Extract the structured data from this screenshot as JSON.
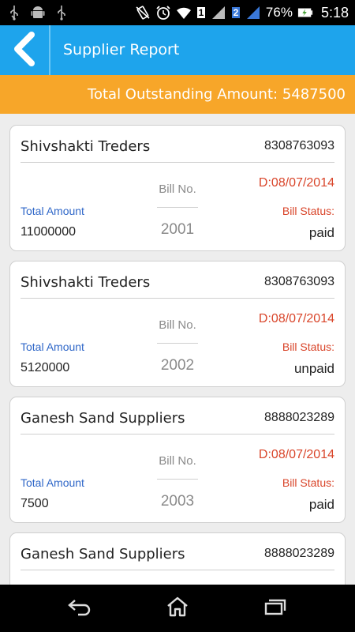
{
  "status_bar": {
    "battery_percent": "76%",
    "time": "5:18",
    "sim_badge_1": "1",
    "sim_badge_2": "2",
    "icons": [
      "usb-icon",
      "android-icon",
      "usb-icon",
      "vibrate-icon",
      "alarm-icon",
      "wifi-icon",
      "signal-icon",
      "signal-icon",
      "battery-charging-icon"
    ]
  },
  "app_bar": {
    "back_icon": "chevron-left-icon",
    "title": "Supplier Report"
  },
  "summary": {
    "label": "Total Outstanding Amount:",
    "amount": "5487500"
  },
  "labels": {
    "bill_no": "Bill No.",
    "total_amount": "Total Amount",
    "bill_status": "Bill Status:"
  },
  "cards": [
    {
      "name": "Shivshakti Treders",
      "phone": "8308763093",
      "date": "D:08/07/2014",
      "bill_no": "2001",
      "total": "11000000",
      "status": "paid"
    },
    {
      "name": "Shivshakti Treders",
      "phone": "8308763093",
      "date": "D:08/07/2014",
      "bill_no": "2002",
      "total": "5120000",
      "status": "unpaid"
    },
    {
      "name": "Ganesh Sand Suppliers",
      "phone": "8888023289",
      "date": "D:08/07/2014",
      "bill_no": "2003",
      "total": "7500",
      "status": "paid"
    },
    {
      "name": "Ganesh Sand Suppliers",
      "phone": "8888023289"
    }
  ],
  "nav_bar": {
    "icons": [
      "back-icon",
      "home-icon",
      "recent-apps-icon"
    ]
  },
  "colors": {
    "app_bar": "#1ea4ec",
    "summary_bar": "#f7a629",
    "date_and_status_label": "#d9452a",
    "total_label": "#2f67c8"
  }
}
